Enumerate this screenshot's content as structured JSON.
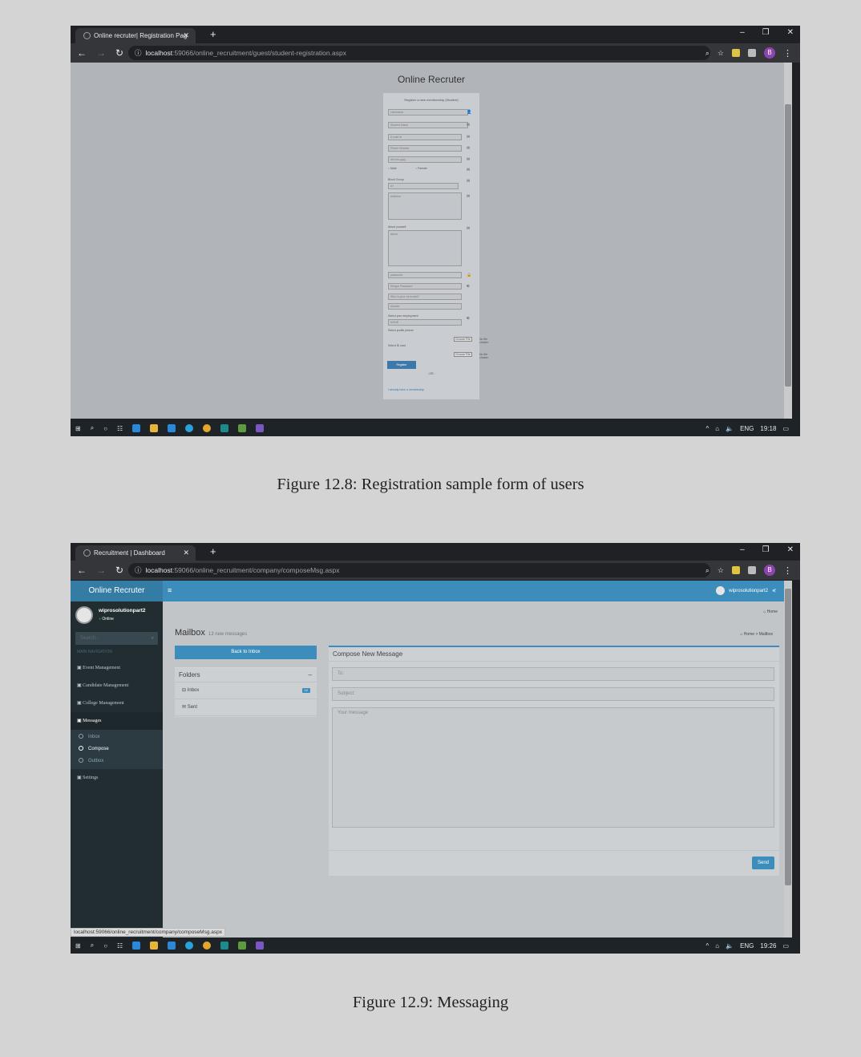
{
  "figure1": {
    "caption": "Figure 12.8: Registration sample form of users",
    "tab_title": "Online recruter| Registration Pag",
    "url_host": "localhost",
    "url_path": ":59066/online_recruitment/guest/student-registration.aspx",
    "brand": "Online Recruter",
    "form": {
      "heading": "Register a new membership (Student)",
      "username": "Username",
      "student_name": "Student Name",
      "email": "E-mail Id",
      "phone": "Phone Number",
      "dob": "dd-mm-yyyy",
      "male": "Male",
      "female": "Female",
      "blood_group_label": "Blood Group",
      "blood_group_value": "A+",
      "address": "Address",
      "about_label": "About yourself",
      "about": "about",
      "password": "password",
      "retype": "Retype Password",
      "question": "Who is your rol model?",
      "answer": "Answer",
      "employment_label": "Select your employment",
      "employment_value": "NONE",
      "profile_label": "Select profile picture",
      "id_label": "Select ID card",
      "choose_file": "Choose File",
      "no_file": "No file chosen",
      "register_btn": "Register",
      "or": "- OR -",
      "member_link": "I already have a membership"
    },
    "clock": "19:18"
  },
  "figure2": {
    "caption": "Figure 12.9: Messaging",
    "tab_title": "Recruitment | Dashboard",
    "url_host": "localhost",
    "url_path": ":59066/online_recruitment/company/composeMsg.aspx",
    "brand": "Online Recruter",
    "user_name": "wiprosolutionpart2",
    "user_status": "Online",
    "search_placeholder": "Search...",
    "nav_header": "MAIN NAVIGATION",
    "nav": {
      "event": "Event Management",
      "candidate": "Candidate Management",
      "college": "College Management",
      "messages": "Messages",
      "inbox": "Inbox",
      "compose": "Compose",
      "outbox": "Outbox",
      "settings": "Settings"
    },
    "top_user": "wiprosolutionpart2",
    "home_link": "Home",
    "mailbox_title": "Mailbox",
    "mailbox_sub": "13 new messages",
    "crumb_home": "Home",
    "crumb_sep": ">",
    "crumb_current": "Mailbox",
    "back_btn": "Back to Inbox",
    "folders_title": "Folders",
    "folder_inbox": "Inbox",
    "inbox_count": "12",
    "folder_sent": "Sent",
    "compose_title": "Compose New Message",
    "to_placeholder": "To:",
    "subject_placeholder": "Subject:",
    "message_placeholder": "Your message",
    "send_btn": "Send",
    "status_url": "localhost:59066/online_recruitment/company/composeMsg.aspx",
    "clock": "19:26"
  },
  "taskbar": {
    "lang": "ENG"
  }
}
